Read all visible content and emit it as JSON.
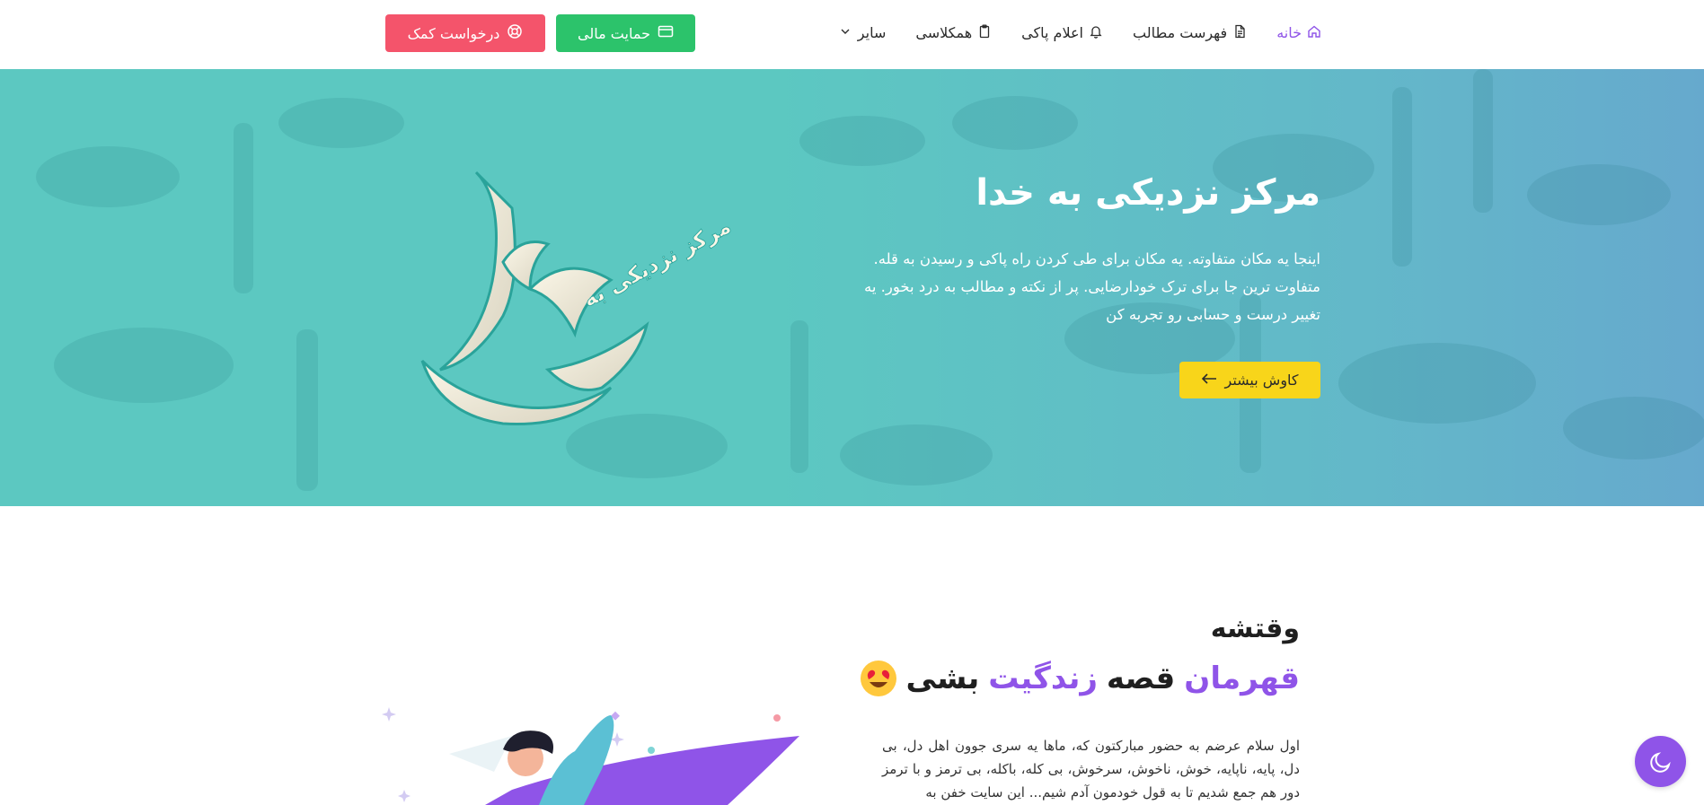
{
  "nav": {
    "items": [
      {
        "label": "خانه",
        "icon": "home-icon",
        "active": true
      },
      {
        "label": "فهرست مطالب",
        "icon": "document-icon",
        "active": false
      },
      {
        "label": "اعلام پاکی",
        "icon": "bell-icon",
        "active": false
      },
      {
        "label": "همکلاسی",
        "icon": "clipboard-icon",
        "active": false
      },
      {
        "label": "سایر",
        "icon": "chevron-down-icon",
        "active": false
      }
    ],
    "donate_label": "حمایت مالی",
    "help_label": "درخواست کمک"
  },
  "hero": {
    "title": "مرکز نزدیکی به خدا",
    "description": "اینجا یه مکان متفاوته. یه مکان برای طی کردن راه پاکی و رسیدن به قله. متفاوت ترین جا برای ترک خودارضایی. پر از نکته و مطالب به درد بخور. یه تغییر درست و حسابی رو تجربه کن",
    "explore_label": "کاوش بیشتر",
    "logo_text_small": "مرکز نزدیکی به",
    "logo_text_big": "خدا"
  },
  "story": {
    "label": "وقتشه",
    "heading_word1": "قهرمان",
    "heading_word2": "قصه",
    "heading_word3": "زندگیت",
    "heading_word4": "بشی",
    "text": "اول سلام عرضم به حضور مبارکتون که، ماها یه سری جوون اهل دل، بی دل، پایه، ناپایه، خوش، ناخوش، سرخوش، بی کله، باکله، بی ترمز و با ترمز دور هم جمع شدیم تا به قول خودمون آدم شیم... این سایت خفن به"
  },
  "colors": {
    "accent": "#8f54e8",
    "donate": "#2cc36b",
    "help": "#f4546b",
    "explore": "#f8d51a",
    "hero_teal": "#5cc8c1"
  }
}
